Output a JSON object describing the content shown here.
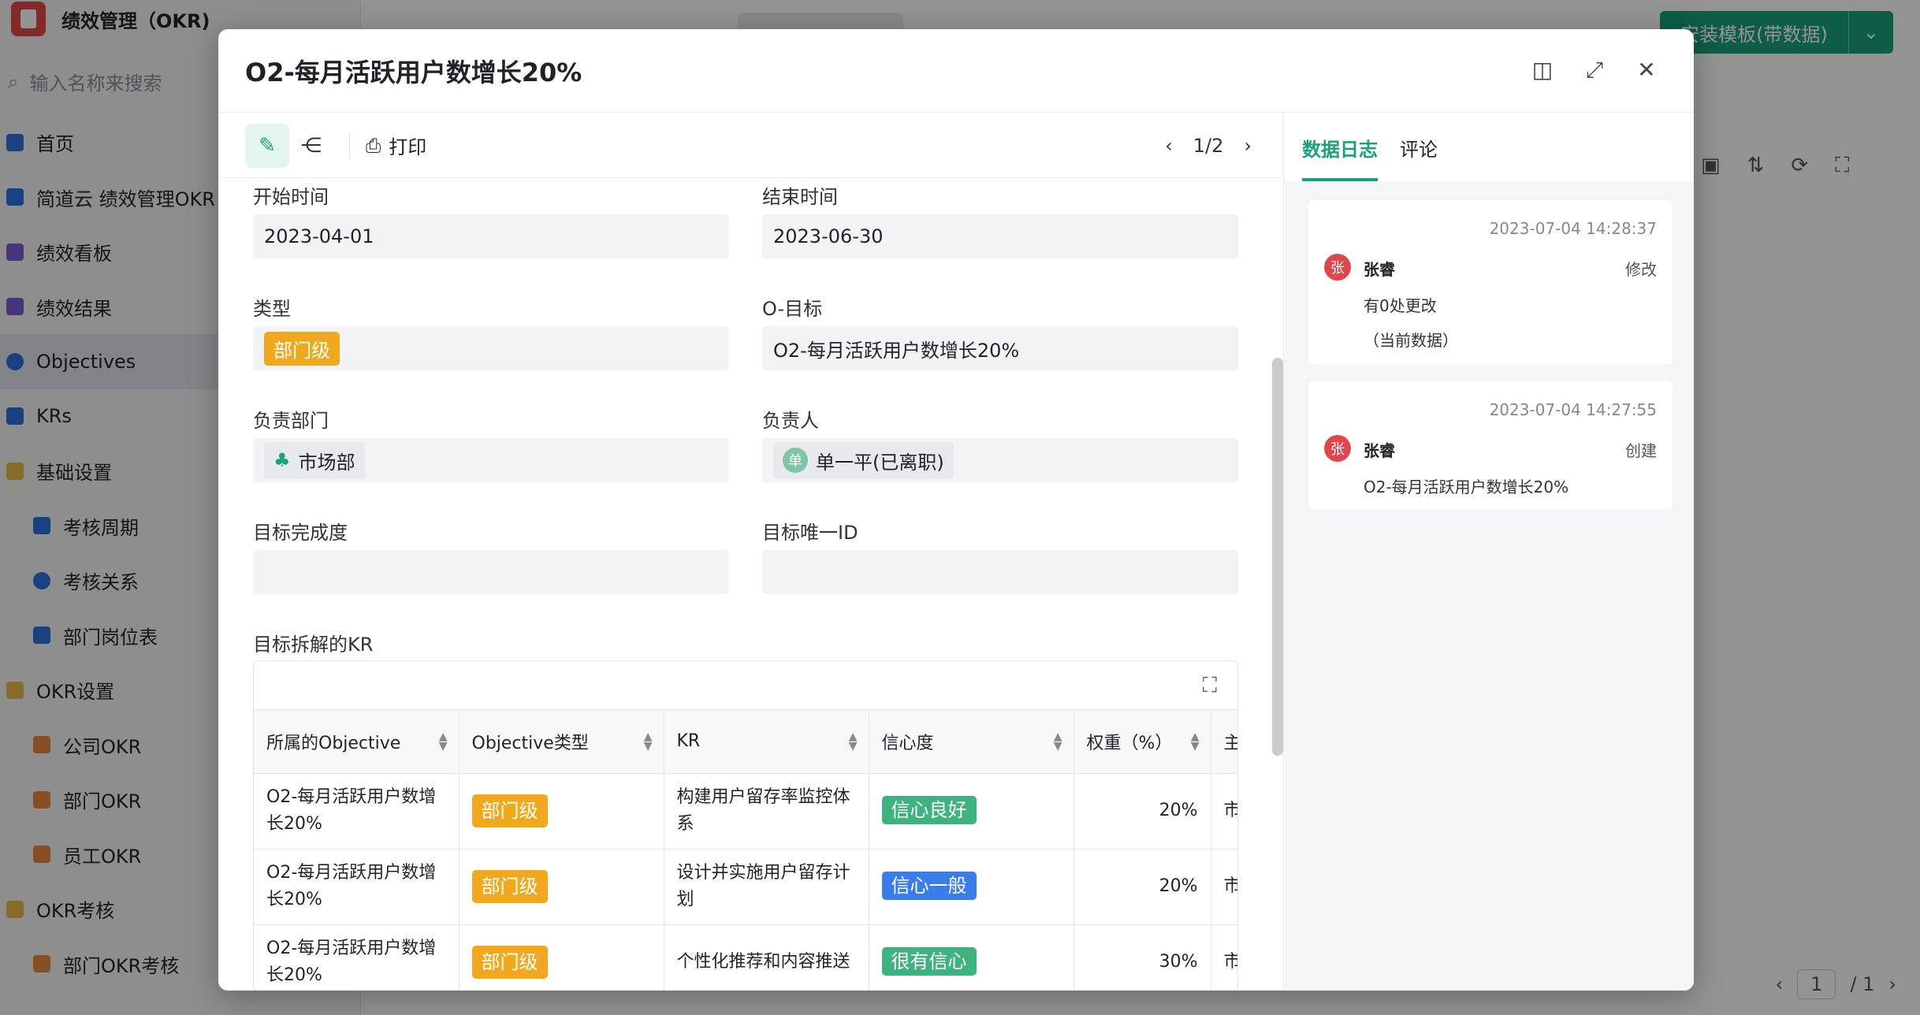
{
  "app": {
    "title": "绩效管理（OKR)"
  },
  "search": {
    "placeholder": "输入名称来搜索"
  },
  "nav": [
    {
      "label": "首页",
      "level": 1,
      "icon": "home-icon",
      "color": "#2f6fde"
    },
    {
      "label": "简道云 绩效管理OKR",
      "level": 1,
      "icon": "form-icon",
      "color": "#2f6fde"
    },
    {
      "label": "绩效看板",
      "level": 1,
      "icon": "dashboard-icon",
      "color": "#7b5cd6"
    },
    {
      "label": "绩效结果",
      "level": 1,
      "icon": "dashboard-icon",
      "color": "#7b5cd6"
    },
    {
      "label": "Objectives",
      "level": 1,
      "icon": "target-icon",
      "color": "#2f6fde",
      "active": true
    },
    {
      "label": "KRs",
      "level": 1,
      "icon": "bookmark-icon",
      "color": "#2f6fde"
    },
    {
      "label": "基础设置",
      "level": 1,
      "icon": "folder-icon",
      "color": "#e9b949"
    },
    {
      "label": "考核周期",
      "level": 2,
      "icon": "form-icon",
      "color": "#2f6fde"
    },
    {
      "label": "考核关系",
      "level": 2,
      "icon": "user-icon",
      "color": "#2f6fde"
    },
    {
      "label": "部门岗位表",
      "level": 2,
      "icon": "form-icon",
      "color": "#2f6fde"
    },
    {
      "label": "OKR设置",
      "level": 1,
      "icon": "folder-icon",
      "color": "#e9b949"
    },
    {
      "label": "公司OKR",
      "level": 2,
      "icon": "chart-icon",
      "color": "#e8893a"
    },
    {
      "label": "部门OKR",
      "level": 2,
      "icon": "chart-icon",
      "color": "#e8893a"
    },
    {
      "label": "员工OKR",
      "level": 2,
      "icon": "chart-icon",
      "color": "#e8893a"
    },
    {
      "label": "OKR考核",
      "level": 1,
      "icon": "folder-icon",
      "color": "#e9b949"
    },
    {
      "label": "部门OKR考核",
      "level": 2,
      "icon": "chart-icon",
      "color": "#e8893a"
    }
  ],
  "topbar": {
    "install_label": "安装模板(带数据)",
    "page_current": "1",
    "page_total": "/ 1"
  },
  "modal": {
    "title": "O2-每月活跃用户数增长20%",
    "print_label": "打印",
    "record_counter": "1/2",
    "fields": {
      "start_label": "开始时间",
      "start_value": "2023-04-01",
      "end_label": "结束时间",
      "end_value": "2023-06-30",
      "type_label": "类型",
      "type_value": "部门级",
      "objective_label": "O-目标",
      "objective_value": "O2-每月活跃用户数增长20%",
      "dept_label": "负责部门",
      "dept_value": "市场部",
      "owner_label": "负责人",
      "owner_avatar": "单",
      "owner_value": "单一平(已离职)",
      "completion_label": "目标完成度",
      "completion_value": "",
      "id_label": "目标唯一ID",
      "id_value": "",
      "kr_label": "目标拆解的KR"
    },
    "kr_table": {
      "headers": [
        "所属的Objective",
        "Objective类型",
        "KR",
        "信心度",
        "权重（%）",
        "主"
      ],
      "rows": [
        {
          "objective": "O2-每月活跃用户数增长20%",
          "type": "部门级",
          "kr": "构建用户留存率监控体系",
          "confidence": "信心良好",
          "confidence_color": "#3fb27f",
          "weight": "20%",
          "more": "市"
        },
        {
          "objective": "O2-每月活跃用户数增长20%",
          "type": "部门级",
          "kr": "设计并实施用户留存计划",
          "confidence": "信心一般",
          "confidence_color": "#3a7dea",
          "weight": "20%",
          "more": "市"
        },
        {
          "objective": "O2-每月活跃用户数增长20%",
          "type": "部门级",
          "kr": "个性化推荐和内容推送",
          "confidence": "很有信心",
          "confidence_color": "#3fb27f",
          "weight": "30%",
          "more": "市"
        }
      ]
    },
    "side": {
      "tab_log": "数据日志",
      "tab_comment": "评论",
      "logs": [
        {
          "time": "2023-07-04 14:28:37",
          "avatar": "张",
          "user": "张睿",
          "action": "修改",
          "text1": "有0处更改",
          "text2": "（当前数据）"
        },
        {
          "time": "2023-07-04 14:27:55",
          "avatar": "张",
          "user": "张睿",
          "action": "创建",
          "text1": "O2-每月活跃用户数增长20%",
          "text2": ""
        }
      ]
    }
  }
}
